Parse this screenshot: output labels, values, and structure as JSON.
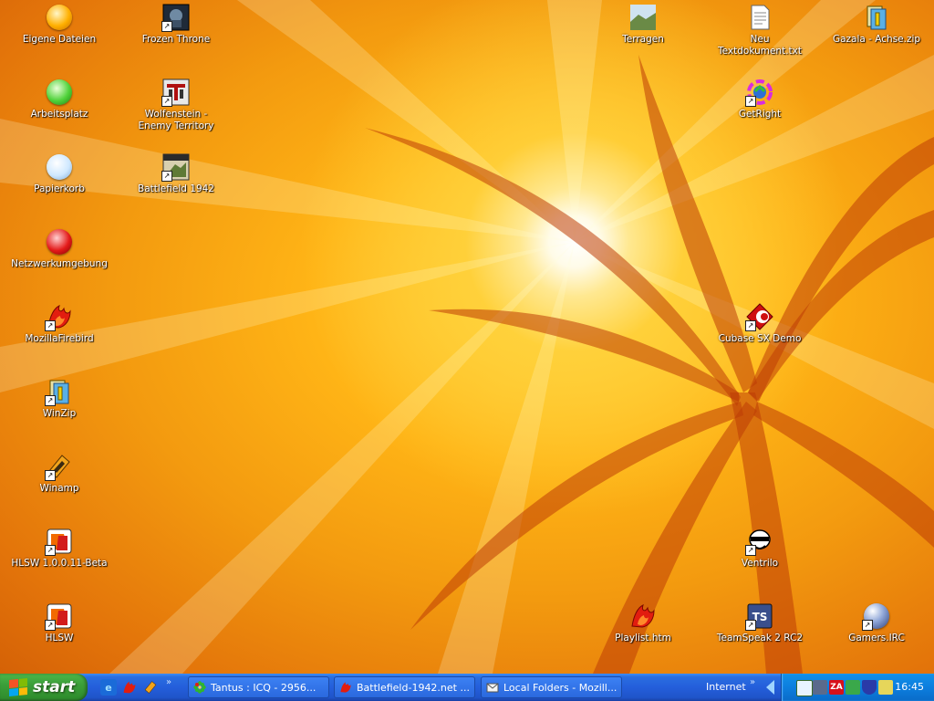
{
  "desktop": {
    "icons": [
      {
        "label": "Eigene Dateien"
      },
      {
        "label": "Arbeitsplatz"
      },
      {
        "label": "Papierkorb"
      },
      {
        "label": "Netzwerkumgebung"
      },
      {
        "label": "MozillaFirebird"
      },
      {
        "label": "WinZip"
      },
      {
        "label": "Winamp"
      },
      {
        "label": "HLSW 1.0.0.11-Beta"
      },
      {
        "label": "HLSW"
      },
      {
        "label": "Frozen Throne"
      },
      {
        "label": "Wolfenstein - Enemy Territory"
      },
      {
        "label": "Battlefield 1942"
      },
      {
        "label": "Terragen"
      },
      {
        "label": "Neu Textdokument.txt"
      },
      {
        "label": "Gazala - Achse.zip"
      },
      {
        "label": "GetRight"
      },
      {
        "label": "Cubase SX Demo"
      },
      {
        "label": "Ventrilo"
      },
      {
        "label": "Playlist.htm"
      },
      {
        "label": "TeamSpeak 2 RC2"
      },
      {
        "label": "Gamers.IRC"
      }
    ]
  },
  "taskbar": {
    "start_label": "start",
    "tasks": [
      {
        "label": "Tantus : ICQ - 2956..."
      },
      {
        "label": "Battlefield-1942.net ..."
      },
      {
        "label": "Local Folders - Mozill..."
      }
    ],
    "address_label": "Internet",
    "tray_zonealarm": "ZA",
    "clock": "16:45"
  },
  "colors": {
    "taskbar_blue": "#245edb",
    "start_green": "#3c9f3a",
    "tray_blue": "#0c7ede"
  }
}
